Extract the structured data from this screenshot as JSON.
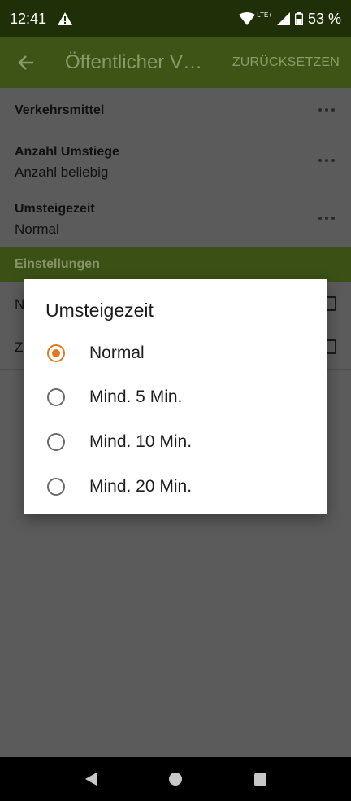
{
  "status_bar": {
    "time": "12:41",
    "network": "LTE+",
    "battery": "53 %"
  },
  "app_bar": {
    "title": "Öffentlicher V…",
    "reset_label": "ZURÜCKSETZEN"
  },
  "preferences": [
    {
      "title": "Verkehrsmittel",
      "summary": ""
    },
    {
      "title": "Anzahl Umstiege",
      "summary": "Anzahl beliebig"
    },
    {
      "title": "Umsteigezeit",
      "summary": "Normal"
    }
  ],
  "section_header": "Einstellungen",
  "background_rows": [
    {
      "letter": "N"
    },
    {
      "letter": "Z"
    }
  ],
  "dialog": {
    "title": "Umsteigezeit",
    "selected_index": 0,
    "options": [
      {
        "label": "Normal"
      },
      {
        "label": "Mind. 5 Min."
      },
      {
        "label": "Mind. 10 Min."
      },
      {
        "label": "Mind. 20 Min."
      }
    ]
  },
  "colors": {
    "status_bar": "#1f3009",
    "app_bar_dimmed": "#3e5417",
    "accent_radio": "#e07a1c",
    "scrim_background": "#5b5b5b"
  }
}
